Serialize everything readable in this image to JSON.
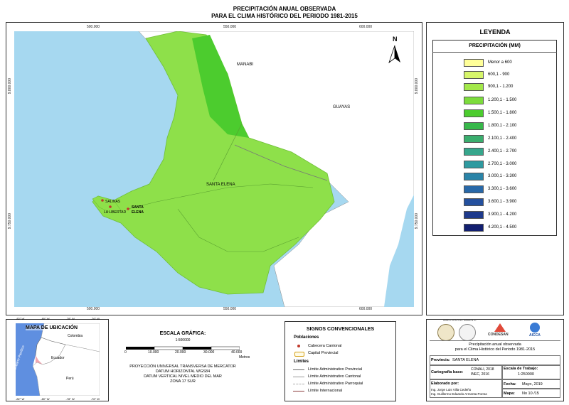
{
  "title": {
    "line1": "PRECIPITACIÓN ANUAL OBSERVADA",
    "line2": "PARA EL CLIMA HISTÓRICO DEL PERIODO 1981-2015"
  },
  "map": {
    "x_ticks": [
      "500.000",
      "550.000",
      "600.000"
    ],
    "y_ticks": [
      "9.800.000",
      "9.750.000"
    ],
    "north_label": "N",
    "labels": {
      "manabi": "MANABI",
      "guayas": "GUAYAS",
      "santa_elena": "SANTA ELENA",
      "salinas": "SALINAS",
      "la_libertad": "LA LIBERTAD",
      "santa_elena_town_1": "SANTA",
      "santa_elena_town_2": "ELENA"
    },
    "colors": {
      "sea": "#a6d8f0",
      "land_light": "#8ee04a",
      "land_dark": "#4ccc2e",
      "land_other": "#ffffff"
    }
  },
  "legend": {
    "title": "LEYENDA",
    "subtitle": "PRECIPITACIÓN (MM)",
    "classes": [
      {
        "label": "Menor a 600",
        "color": "#ffff99"
      },
      {
        "label": "600,1 - 900",
        "color": "#d6f56a"
      },
      {
        "label": "900,1 - 1.200",
        "color": "#a3e84a"
      },
      {
        "label": "1.200,1 - 1.500",
        "color": "#7cdc3c"
      },
      {
        "label": "1.500,1 - 1.800",
        "color": "#4ccc2e"
      },
      {
        "label": "1.800,1 - 2.100",
        "color": "#37b84a"
      },
      {
        "label": "2.100,1 - 2.400",
        "color": "#3aae6e"
      },
      {
        "label": "2.400,1 - 2.700",
        "color": "#36a68c"
      },
      {
        "label": "2.700,1 - 3.000",
        "color": "#2e9aa0"
      },
      {
        "label": "3.000,1 - 3.300",
        "color": "#2a84a8"
      },
      {
        "label": "3.300,1 - 3.600",
        "color": "#2868a8"
      },
      {
        "label": "3.600,1 - 3.900",
        "color": "#24509e"
      },
      {
        "label": "3.900,1 - 4.200",
        "color": "#1e3a8c"
      },
      {
        "label": "4.200,1 - 4.500",
        "color": "#121f70"
      }
    ]
  },
  "location_map": {
    "title": "MAPA DE UBICACIÓN",
    "top_ticks": [
      "-82° W",
      "-80° W",
      "-78° W",
      "-76° W"
    ],
    "bottom_ticks": [
      "-82° W",
      "-80° W",
      "-78° W",
      "-76° W"
    ],
    "colombia": "Colombia",
    "ecuador": "Ecuador",
    "peru": "Perú",
    "ocean": "Océano Pacífico"
  },
  "scale": {
    "title": "ESCALA GRÁFICA:",
    "ratio": "1:500000",
    "ticks": [
      "0",
      "10.000",
      "20.000",
      "30.000",
      "40.000"
    ],
    "unit": "Metros",
    "projection": [
      "PROYECCIÓN UNIVERSAL TRANSVERSA DE MERCATOR",
      "DATUM HORIZONTAL WGS84",
      "DATUM VERTICAL NIVEL MEDIO DEL MAR",
      "ZONA 17 SUR"
    ]
  },
  "signs": {
    "title": "SIGNOS CONVENCIONALES",
    "pob_title": "Poblaciones",
    "pob": [
      "Cabecera Cantonal",
      "Capital Provincial"
    ],
    "lim_title": "Límites",
    "lim": [
      "Límite Administrativo Provincial",
      "Límite Administrativo Cantonal",
      "Límite Administrativo Parroquial",
      "Límite Internacional"
    ]
  },
  "info": {
    "logo1": "MINISTERIO DEL AMBIENTE",
    "logo2": "CONDESAN",
    "logo3": "AICCA",
    "description_1": "Precipitación anual observada",
    "description_2": "para el Clima Histórico del Periodo 1981-2015",
    "province_label": "Provincia:",
    "province": "SANTA ELENA",
    "carto_label": "Cartografía base:",
    "carto_1": "CONALI, 2018",
    "carto_2": "INEC, 2016",
    "scale_label": "Escala de Trabajo:",
    "scale_value": "1:250000",
    "elaborado_label": "Elaborado por:",
    "author_1": "Ing. Jorge Luis Villa Cedeño",
    "author_2": "Ing. Guillermo Eduardo Armenta Porras",
    "fecha_label": "Fecha:",
    "fecha": "Mayo, 2019",
    "mapa_label": "Mapa:",
    "mapa": "No 10 /15"
  }
}
